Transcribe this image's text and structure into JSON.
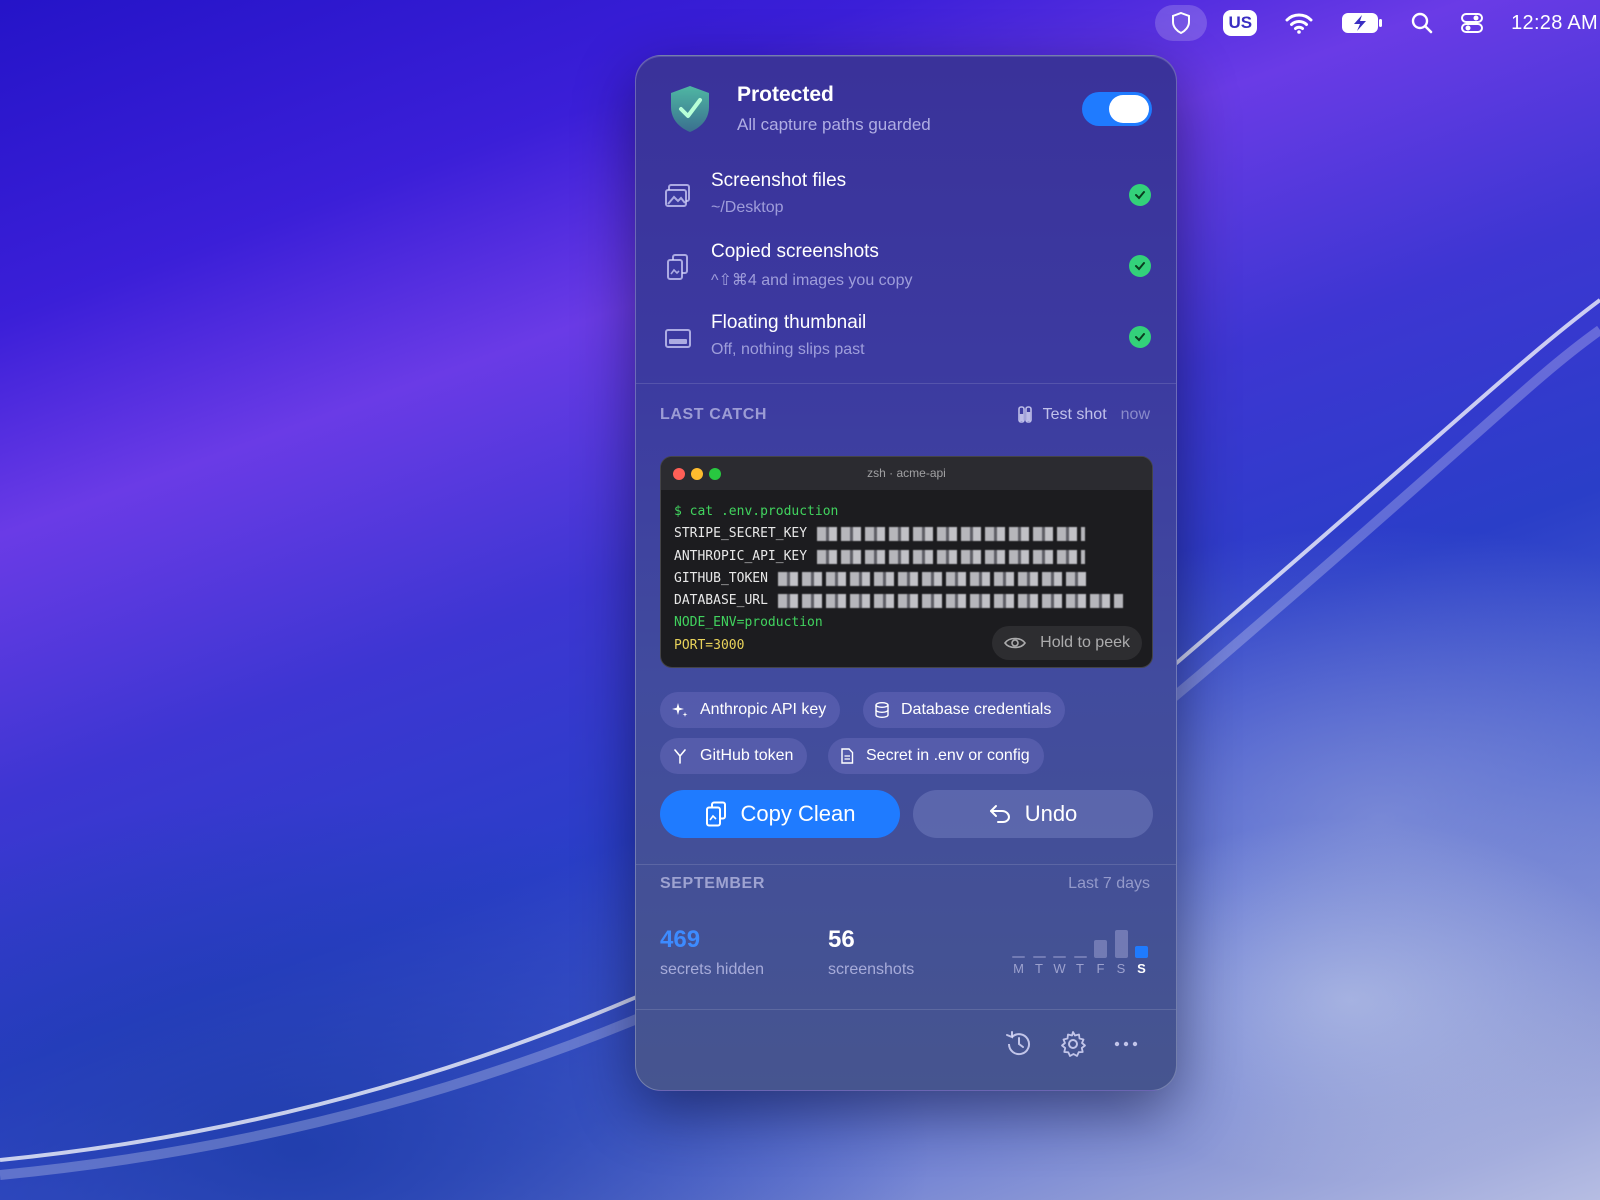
{
  "menubar": {
    "input_source": "US",
    "clock": "12:28 AM",
    "icons": [
      "shield-icon",
      "wifi-icon",
      "battery-charging-icon",
      "search-icon",
      "control-center-icon"
    ]
  },
  "panel": {
    "status_title": "Protected",
    "status_subtitle": "All capture paths guarded",
    "protection_enabled": true,
    "paths": [
      {
        "title": "Screenshot files",
        "subtitle": "~/Desktop",
        "icon": "photos-icon",
        "ok": true
      },
      {
        "title": "Copied screenshots",
        "subtitle": "^⇧⌘4 and images you copy",
        "icon": "clipboard-icon",
        "ok": true
      },
      {
        "title": "Floating thumbnail",
        "subtitle": "Off, nothing slips past",
        "icon": "thumbnail-icon",
        "ok": true
      }
    ],
    "last_catch": {
      "label": "LAST CATCH",
      "source": "Test shot",
      "time": "now",
      "terminal": {
        "title": "zsh · acme-api",
        "command": "$ cat .env.production",
        "keys": [
          "STRIPE_SECRET_KEY",
          "ANTHROPIC_API_KEY",
          "GITHUB_TOKEN",
          "DATABASE_URL"
        ],
        "plain_lines": [
          "NODE_ENV=production",
          "PORT=3000"
        ],
        "peek_label": "Hold to peek"
      },
      "detections": [
        "Anthropic API key",
        "Database credentials",
        "GitHub token",
        "Secret in .env or config"
      ]
    },
    "actions": {
      "primary": "Copy Clean",
      "secondary": "Undo"
    },
    "stats": {
      "month_label": "SEPTEMBER",
      "range_label": "Last 7 days",
      "secrets_hidden": "469",
      "secrets_hidden_label": "secrets hidden",
      "screenshots": "56",
      "screenshots_label": "screenshots",
      "week_days": [
        "M",
        "T",
        "W",
        "T",
        "F",
        "S",
        "S"
      ],
      "week_values": [
        0,
        0,
        0,
        0,
        0.45,
        0.7,
        0.2
      ],
      "accent": "#1f7bff"
    },
    "footer_icons": [
      "history-icon",
      "gear-icon",
      "more-icon"
    ]
  }
}
